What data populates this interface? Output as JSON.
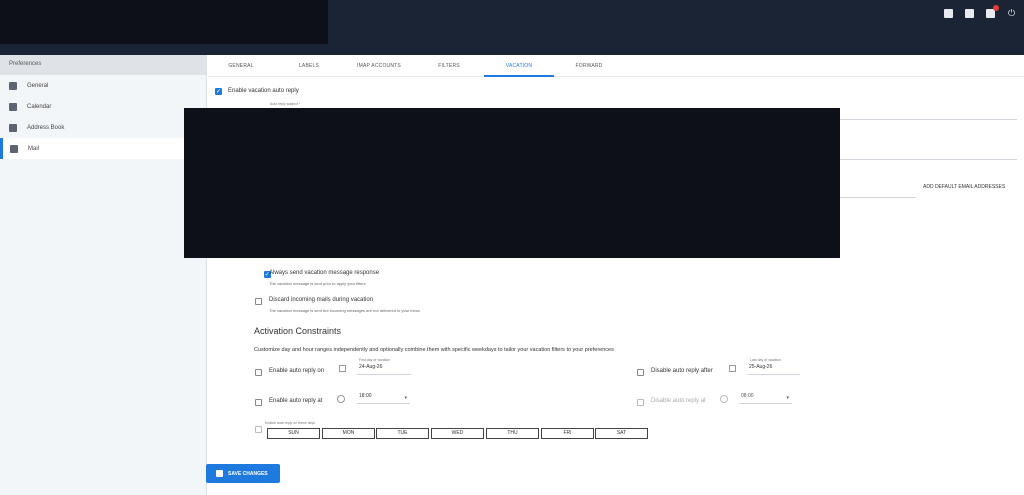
{
  "sidebar": {
    "header": "Preferences",
    "items": [
      {
        "label": "General"
      },
      {
        "label": "Calendar"
      },
      {
        "label": "Address Book"
      },
      {
        "label": "Mail"
      }
    ]
  },
  "tabs": [
    "GENERAL",
    "LABELS",
    "IMAP ACCOUNTS",
    "FILTERS",
    "VACATION",
    "FORWARD"
  ],
  "vacation": {
    "enable_label": "Enable vacation auto reply",
    "subject_label": "Auto reply subject *",
    "add_default_label": "ADD DEFAULT EMAIL ADDRESSES",
    "always_send_label": "Always send vacation message response",
    "always_send_help": "The vacation message is sent prior to apply your filters",
    "discard_label": "Discard incoming mails during vacation",
    "discard_help": "The vacation message is sent but incoming messages are not delivered to your inbox",
    "constraints_title": "Activation Constraints",
    "constraints_desc": "Customize day and hour ranges independently and optionally combine them with specific weekdays to tailor your vacation filters to your preferences",
    "enable_on_label": "Enable auto reply on",
    "first_day_label": "First day of vacation",
    "first_day_value": "24-Aug-26",
    "disable_after_label": "Disable auto reply after",
    "last_day_label": "Last day of vacation",
    "last_day_value": "25-Aug-26",
    "enable_at_label": "Enable auto reply at",
    "enable_at_value": "18:00",
    "disable_at_label": "Disable auto reply at",
    "disable_at_value": "08:00",
    "days_label": "Enable auto reply on these days",
    "days": [
      "SUN",
      "MON",
      "TUE",
      "WED",
      "THU",
      "FRI",
      "SAT"
    ],
    "save_label": "SAVE CHANGES"
  },
  "colors": {
    "accent": "#1f7ae0",
    "topbar": "#1b2435"
  },
  "icons": [
    "calendar-icon",
    "contacts-icon",
    "mail-icon",
    "power-icon",
    "gear-icon",
    "clock-icon",
    "save-icon"
  ]
}
